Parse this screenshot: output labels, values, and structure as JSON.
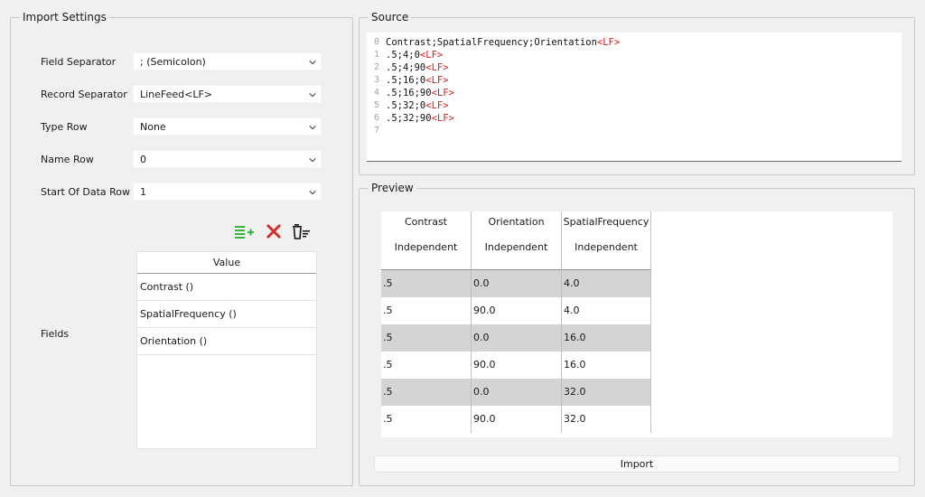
{
  "import_settings": {
    "title": "Import Settings",
    "field_separator": {
      "label": "Field Separator",
      "value": "; (Semicolon)"
    },
    "record_separator": {
      "label": "Record Separator",
      "value": "LineFeed<LF>"
    },
    "type_row": {
      "label": "Type Row",
      "value": "None"
    },
    "name_row": {
      "label": "Name Row",
      "value": "0"
    },
    "start_of_data_row": {
      "label": "Start Of Data Row",
      "value": "1"
    },
    "fields_label": "Fields",
    "fields_table": {
      "header": "Value",
      "rows": [
        "Contrast ()",
        "SpatialFrequency ()",
        "Orientation ()"
      ]
    },
    "toolbar_icons": [
      "add-list-icon",
      "delete-x-icon",
      "clear-list-icon"
    ],
    "colors": {
      "add": "#3cb043",
      "delete": "#d32f2f"
    }
  },
  "source": {
    "title": "Source",
    "line_numbers": [
      "0",
      "1",
      "2",
      "3",
      "4",
      "5",
      "6",
      "7"
    ],
    "lines": [
      "Contrast;SpatialFrequency;Orientation",
      ".5;4;0",
      ".5;4;90",
      ".5;16;0",
      ".5;16;90",
      ".5;32;0",
      ".5;32;90"
    ],
    "line_terminator": "<LF>",
    "terminator_color": "#d81b1b"
  },
  "preview": {
    "title": "Preview",
    "columns": [
      {
        "name": "Contrast",
        "type": "Independent"
      },
      {
        "name": "Orientation",
        "type": "Independent"
      },
      {
        "name": "SpatialFrequency",
        "type": "Independent"
      }
    ],
    "rows": [
      [
        ".5",
        "0.0",
        "4.0"
      ],
      [
        ".5",
        "90.0",
        "4.0"
      ],
      [
        ".5",
        "0.0",
        "16.0"
      ],
      [
        ".5",
        "90.0",
        "16.0"
      ],
      [
        ".5",
        "0.0",
        "32.0"
      ],
      [
        ".5",
        "90.0",
        "32.0"
      ]
    ],
    "import_button": "Import"
  }
}
